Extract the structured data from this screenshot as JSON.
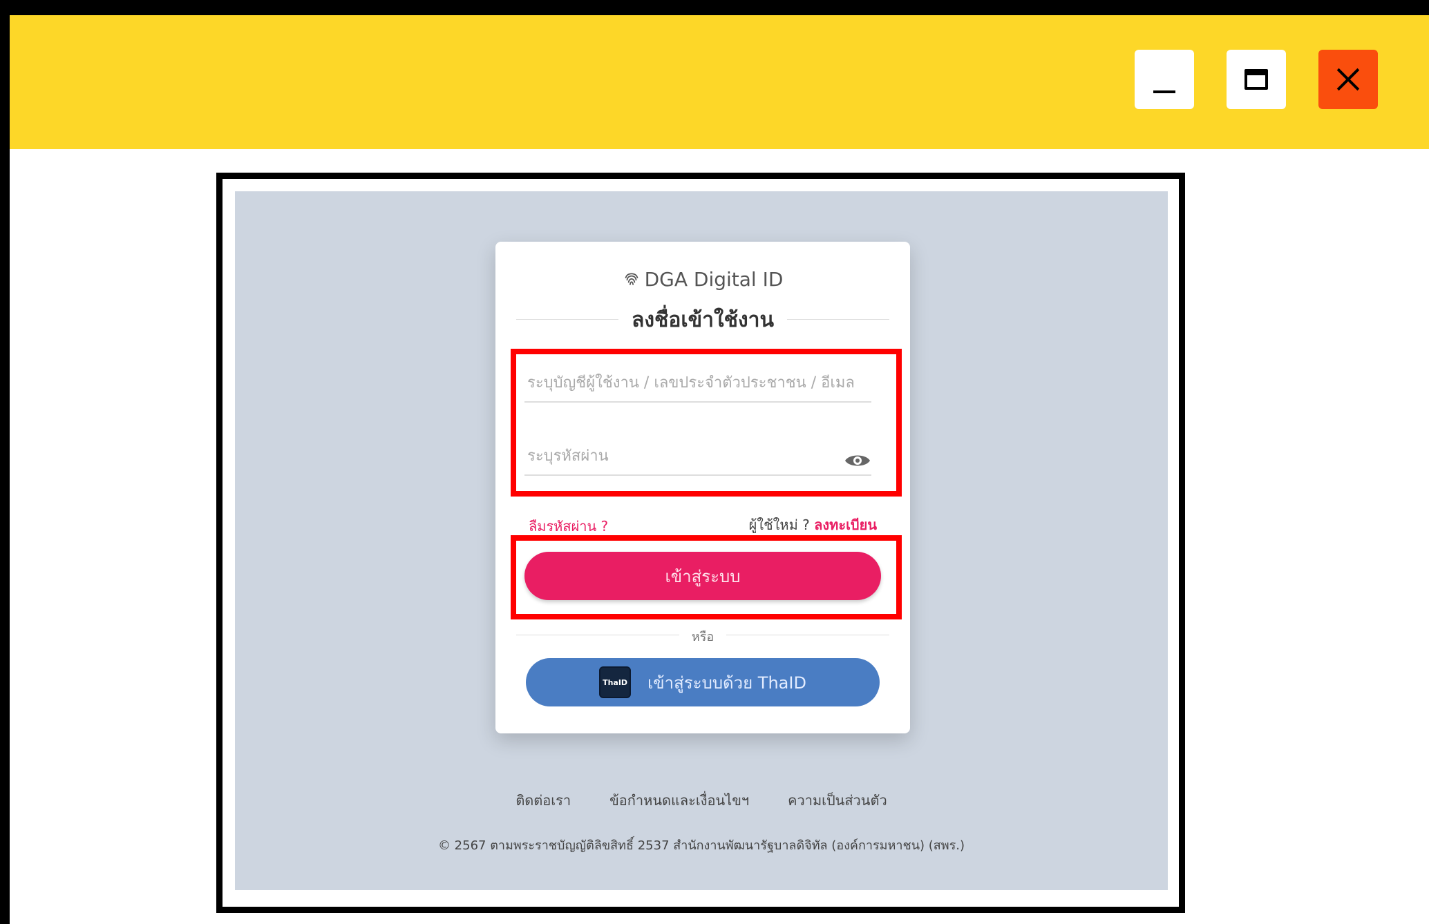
{
  "window": {
    "controls": [
      "minimize-icon",
      "maximize-icon",
      "close-icon"
    ],
    "titlebar_color": "#fdd728",
    "close_color": "#fa4e0d"
  },
  "login": {
    "brand": "DGA Digital ID",
    "brand_icon": "fingerprint-icon",
    "heading": "ลงชื่อเข้าใช้งาน",
    "username_placeholder": "ระบุบัญชีผู้ใช้งาน / เลขประจำตัวประชาชน / อีเมล",
    "password_placeholder": "ระบุรหัสผ่าน",
    "forgot_password": "ลืมรหัสผ่าน ?",
    "new_user": "ผู้ใช้ใหม่ ?",
    "register": "ลงทะเบียน",
    "login_button": "เข้าสู่ระบบ",
    "or": "หรือ",
    "thaid_logo_text": "ThaID",
    "thaid_button": "เข้าสู่ระบบด้วย ThaID"
  },
  "footer": {
    "contact": "ติดต่อเรา",
    "terms": "ข้อกำหนดและเงื่อนไขฯ",
    "privacy": "ความเป็นส่วนตัว",
    "copyright": "© 2567 ตามพระราชบัญญัติลิขสิทธิ์ 2537 สำนักงานพัฒนารัฐบาลดิจิทัล (องค์การมหาชน) (สพร.)"
  },
  "colors": {
    "accent": "#e91e63",
    "thaid": "#4a7dc3",
    "highlight": "#ff0000",
    "background": "#cdd5e0"
  }
}
